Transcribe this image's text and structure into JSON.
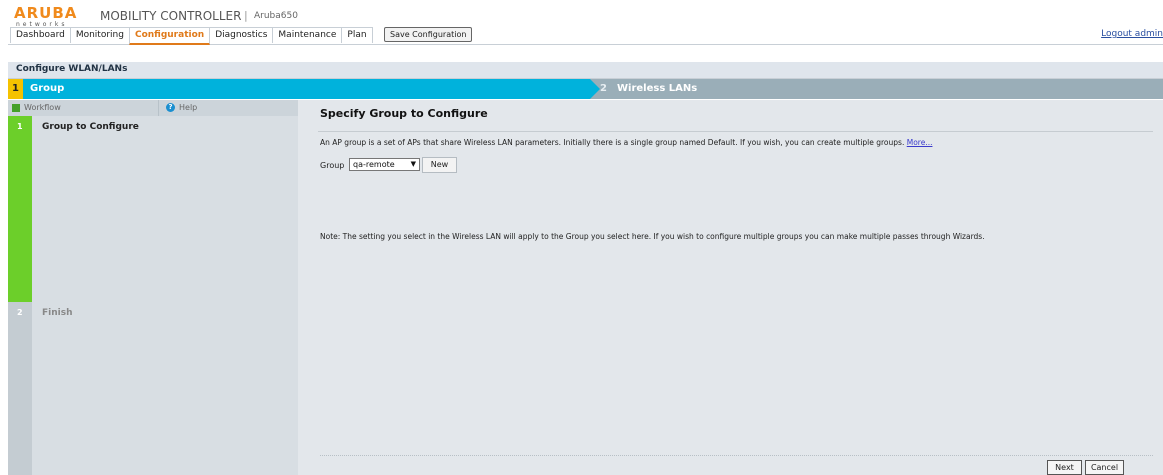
{
  "header": {
    "logo_word": "ARUBA",
    "logo_sub": "networks",
    "product_title": "MOBILITY CONTROLLER",
    "separator": "|",
    "model": "Aruba650",
    "nav_tabs": [
      "Dashboard",
      "Monitoring",
      "Configuration",
      "Diagnostics",
      "Maintenance",
      "Plan"
    ],
    "active_tab": "Configuration",
    "save_button": "Save Configuration",
    "logout_link": "Logout admin"
  },
  "page_title": "Configure WLAN/LANs",
  "steps": [
    {
      "number": "1",
      "label": "Group"
    },
    {
      "number": "2",
      "label": "Wireless LANs"
    }
  ],
  "left_panel": {
    "workflow_label": "Workflow",
    "help_label": "Help",
    "items": [
      {
        "number": "1",
        "label": "Group to Configure"
      },
      {
        "number": "2",
        "label": "Finish"
      }
    ]
  },
  "main": {
    "title": "Specify Group to Configure",
    "description": "An AP group is a set of APs that share Wireless LAN parameters. Initially there is a single group named Default. If you wish, you can create multiple groups.",
    "more_link": "More...",
    "group_label": "Group",
    "group_value": "qa-remote",
    "new_button": "New",
    "note": "Note: The setting you select in the Wireless LAN will apply to the Group you select here. If you wish to configure multiple groups you can make multiple passes through Wizards.",
    "next_button": "Next",
    "cancel_button": "Cancel"
  },
  "colors": {
    "step_active": "#00b2dc",
    "step_number_bg": "#f5c200",
    "step_inactive": "#9aaeb8",
    "workflow_green": "#6ccf2a",
    "accent_orange": "#e07a1a"
  }
}
